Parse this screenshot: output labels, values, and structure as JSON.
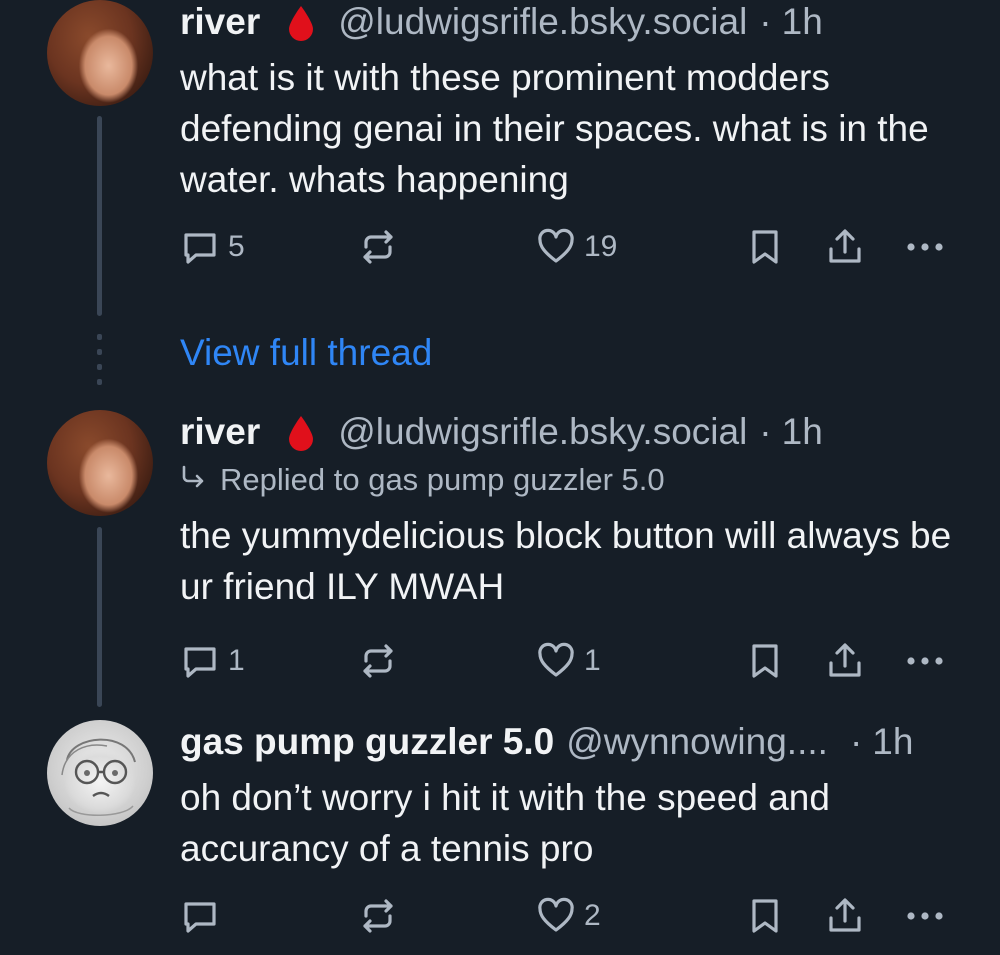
{
  "posts": [
    {
      "author": "river",
      "handle": "@ludwigsrifle.bsky.social",
      "separator": "·",
      "time": "1h",
      "reply_to": "",
      "text": "what is it with these prominent modders defending genai in their spaces. what is in the water. whats happening",
      "counts": {
        "reply": "5",
        "repost": "",
        "like": "19"
      },
      "avatar_icon": "river-avatar"
    },
    {
      "author": "river",
      "handle": "@ludwigsrifle.bsky.social",
      "separator": "·",
      "time": "1h",
      "reply_to": "Replied to gas pump guzzler 5.0",
      "text": "the yummydelicious block button will always be ur friend ILY MWAH",
      "counts": {
        "reply": "1",
        "repost": "",
        "like": "1"
      },
      "avatar_icon": "river-avatar"
    },
    {
      "author": "gas pump guzzler 5.0",
      "handle": "@wynnowing....",
      "separator": "·",
      "time": "1h",
      "reply_to": "",
      "text": "oh don’t worry i hit it with the speed and accurancy of a tennis pro",
      "counts": {
        "reply": "",
        "repost": "",
        "like": "2"
      },
      "avatar_icon": "gas-pump-avatar"
    }
  ],
  "view_full_thread": "View full thread",
  "colors": {
    "background": "#161e27",
    "text": "#f1f3f5",
    "muted": "#aeb8c4",
    "link": "#2f86f6",
    "drop": "#e0101b",
    "thread_line": "#3a4656"
  }
}
